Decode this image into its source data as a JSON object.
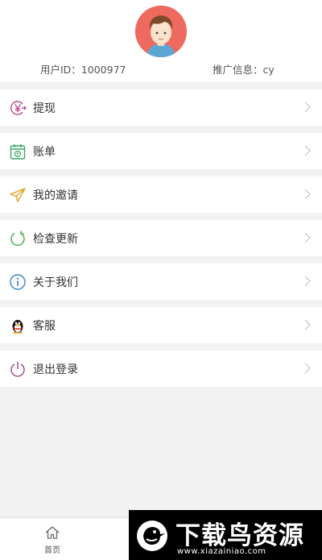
{
  "profile": {
    "user_id": "用户ID：1000977",
    "promo_info": "推广信息：cy"
  },
  "menu": {
    "items": [
      {
        "label": "提现",
        "icon": "yen-withdraw-icon"
      },
      {
        "label": "账单",
        "icon": "bill-calendar-icon"
      },
      {
        "label": "我的邀请",
        "icon": "paper-plane-icon"
      },
      {
        "label": "检查更新",
        "icon": "refresh-icon"
      },
      {
        "label": "关于我们",
        "icon": "info-icon"
      },
      {
        "label": "客服",
        "icon": "qq-penguin-icon"
      },
      {
        "label": "退出登录",
        "icon": "power-icon"
      }
    ]
  },
  "tabbar": {
    "home_label": "首页"
  },
  "watermark": {
    "title": "下载鸟资源",
    "url": "www.xiazainiao.com"
  }
}
